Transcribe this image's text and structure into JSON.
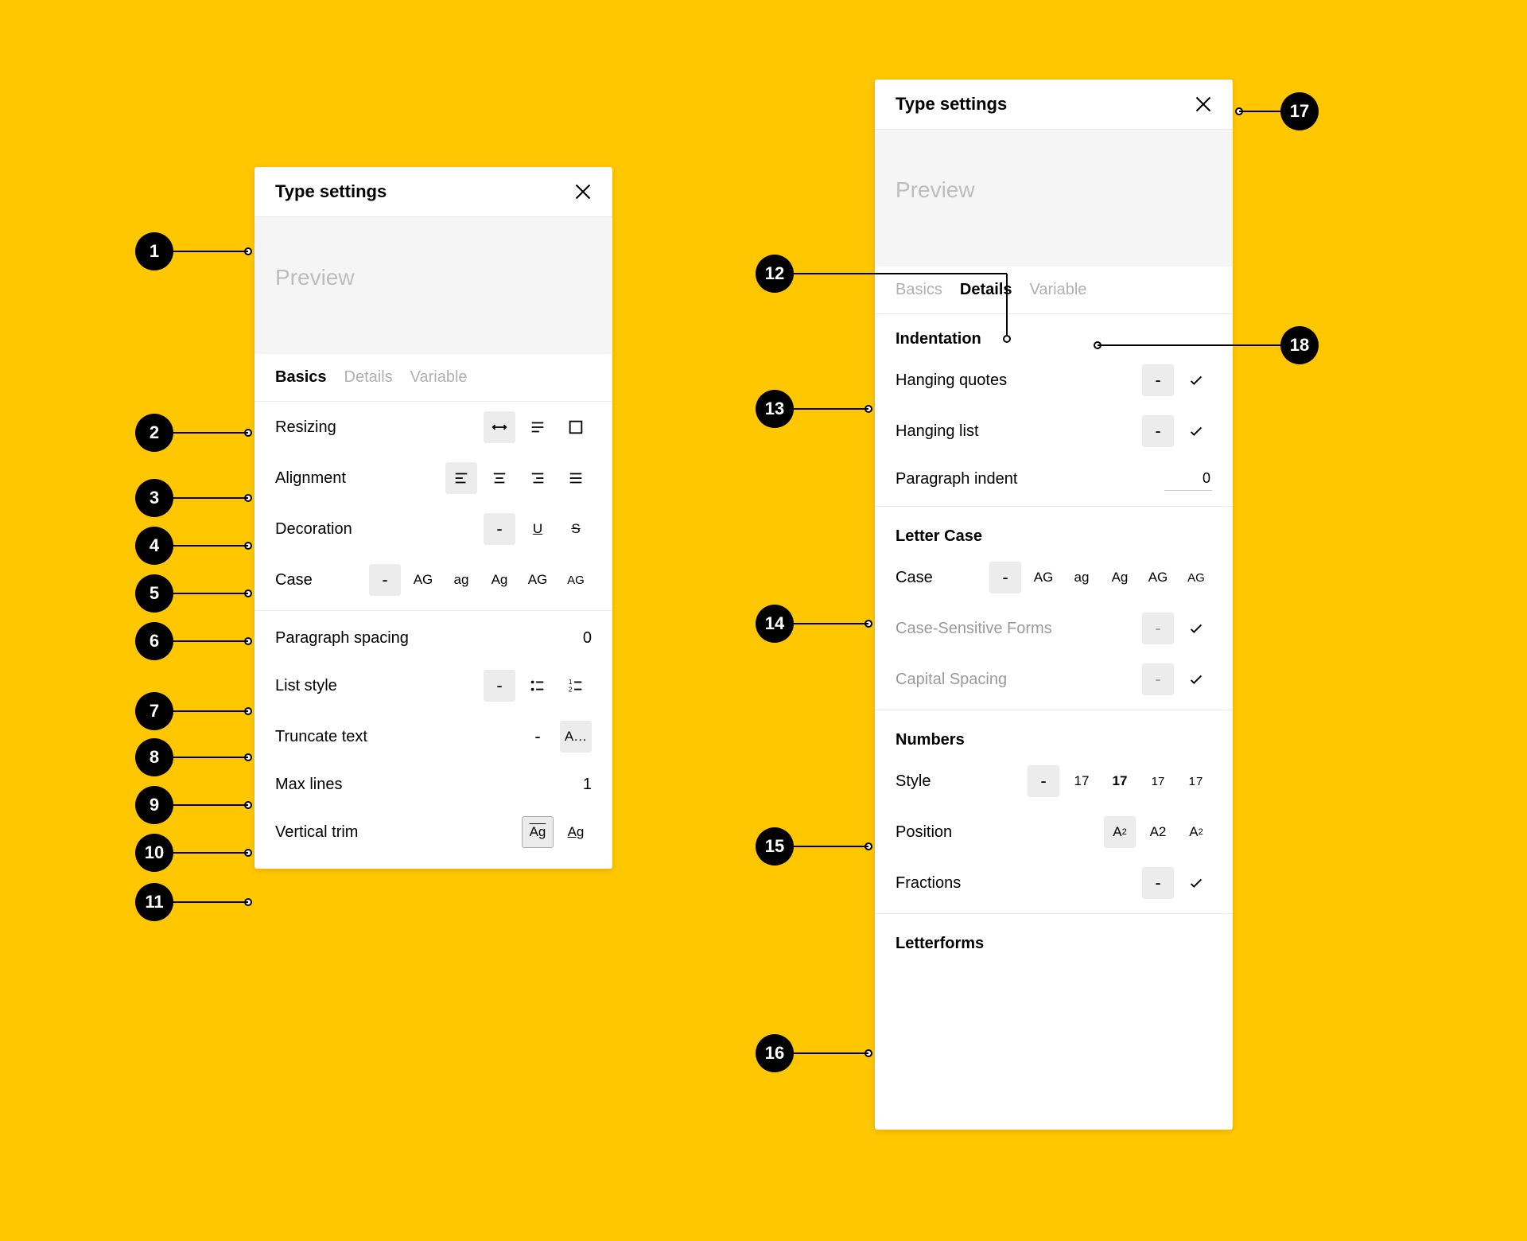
{
  "title": "Type settings",
  "preview_placeholder": "Preview",
  "tabs": {
    "basics": "Basics",
    "details": "Details",
    "variable": "Variable"
  },
  "left": {
    "resizing": {
      "label": "Resizing"
    },
    "alignment": {
      "label": "Alignment"
    },
    "decoration": {
      "label": "Decoration"
    },
    "case": {
      "label": "Case",
      "opts": [
        "AG",
        "ag",
        "Ag",
        "AG",
        "AG"
      ]
    },
    "para_spacing": {
      "label": "Paragraph spacing",
      "value": "0"
    },
    "list_style": {
      "label": "List style"
    },
    "truncate": {
      "label": "Truncate text",
      "active_glyph": "A…"
    },
    "max_lines": {
      "label": "Max lines",
      "value": "1"
    },
    "vtrim": {
      "label": "Vertical trim",
      "glyph": "Ag"
    }
  },
  "right": {
    "indent": {
      "heading": "Indentation",
      "hanging_quotes": "Hanging quotes",
      "hanging_list": "Hanging list",
      "para_indent": {
        "label": "Paragraph indent",
        "value": "0"
      }
    },
    "letter_case": {
      "heading": "Letter Case",
      "case_label": "Case",
      "case_opts": [
        "AG",
        "ag",
        "Ag",
        "AG",
        "AG"
      ],
      "case_sensitive": "Case-Sensitive Forms",
      "capital_spacing": "Capital Spacing"
    },
    "numbers": {
      "heading": "Numbers",
      "style_label": "Style",
      "style_opts": [
        "17",
        "17",
        "17",
        "17"
      ],
      "position_label": "Position",
      "fractions_label": "Fractions"
    },
    "letterforms": {
      "heading": "Letterforms"
    }
  },
  "annotations": {
    "1": "1",
    "2": "2",
    "3": "3",
    "4": "4",
    "5": "5",
    "6": "6",
    "7": "7",
    "8": "8",
    "9": "9",
    "10": "10",
    "11": "11",
    "12": "12",
    "13": "13",
    "14": "14",
    "15": "15",
    "16": "16",
    "17": "17",
    "18": "18"
  }
}
